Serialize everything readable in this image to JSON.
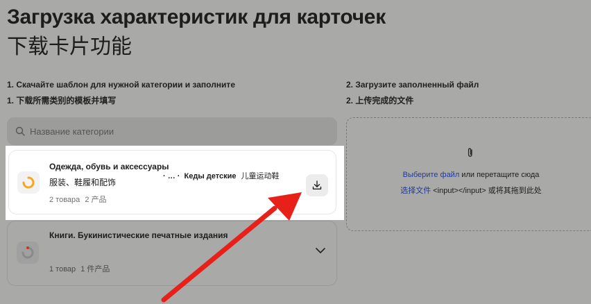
{
  "header": {
    "title": "Загрузка характеристик для карточек",
    "title_cn": "下载卡片功能"
  },
  "steps": {
    "step1": "1. Скачайте шаблон для нужной категории и заполните",
    "step1_cn": "1. 下载所需类别的模板并填写",
    "step2": "2. Загрузите заполненный файл",
    "step2_cn": "2. 上传完成的文件"
  },
  "search": {
    "placeholder": "Название категории",
    "icon": "search-icon"
  },
  "categories": [
    {
      "name": "Одежда, обувь и аксессуары",
      "name_cn": "服装、鞋履和配饰",
      "crumb_dots": "· … ·",
      "crumb_leaf": "Кеды детские",
      "crumb_leaf_cn": "儿童运动鞋",
      "count": "2 товара",
      "count_cn": "2 产品",
      "icon": "loading-ring-icon",
      "icon_color": "#f5a623",
      "action_icon": "download-icon"
    },
    {
      "name": "Книги. Букинистические печатные издания",
      "count": "1 товар",
      "count_cn": "1 件产品",
      "icon": "loading-ring-icon",
      "icon_color": "#d0302a",
      "action_icon": "chevron-down-icon"
    }
  ],
  "upload": {
    "link": "Выберите файл",
    "text": " или перетащите сюда",
    "link_cn": "选择文件",
    "text_cn": " <input></input> 或将其拖到此处",
    "icon": "paperclip-icon"
  },
  "colors": {
    "overlay": "#a9a9a8",
    "highlight": "#ffffff",
    "arrow": "#e8201a",
    "link": "#1f3a9a"
  }
}
